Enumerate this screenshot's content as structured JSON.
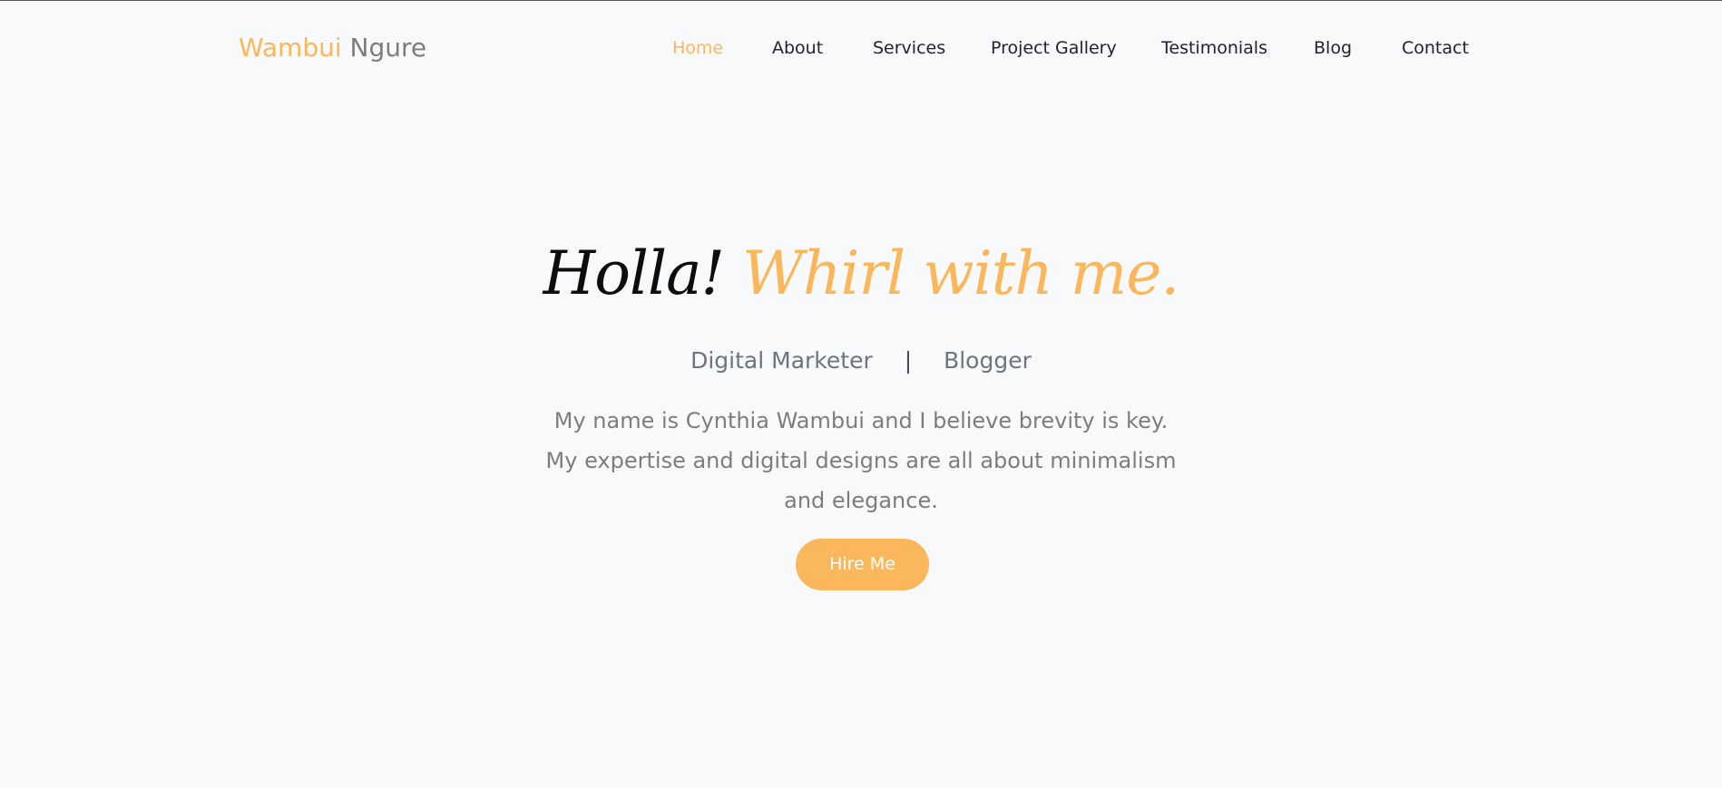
{
  "brand": {
    "first": "Wambui",
    "last": "Ngure"
  },
  "nav": {
    "items": [
      {
        "label": "Home",
        "active": true
      },
      {
        "label": "About",
        "active": false
      },
      {
        "label": "Services",
        "active": false
      },
      {
        "label": "Project Gallery",
        "active": false
      },
      {
        "label": "Testimonials",
        "active": false
      },
      {
        "label": "Blog",
        "active": false
      },
      {
        "label": "Contact",
        "active": false
      }
    ]
  },
  "hero": {
    "title_greeting": "Holla!",
    "title_accent": "Whirl with me.",
    "role_1": "Digital Marketer",
    "role_separator": "|",
    "role_2": "Blogger",
    "intro_lines": [
      "My name is Cynthia Wambui and I believe brevity is key.",
      "My expertise and digital designs are all about minimalism",
      "and elegance."
    ],
    "cta_label": "Hire Me"
  },
  "colors": {
    "accent": "#fbb75b",
    "background": "#f8f9fa",
    "text_dark": "#212529",
    "text_muted": "#7d7d7d"
  }
}
